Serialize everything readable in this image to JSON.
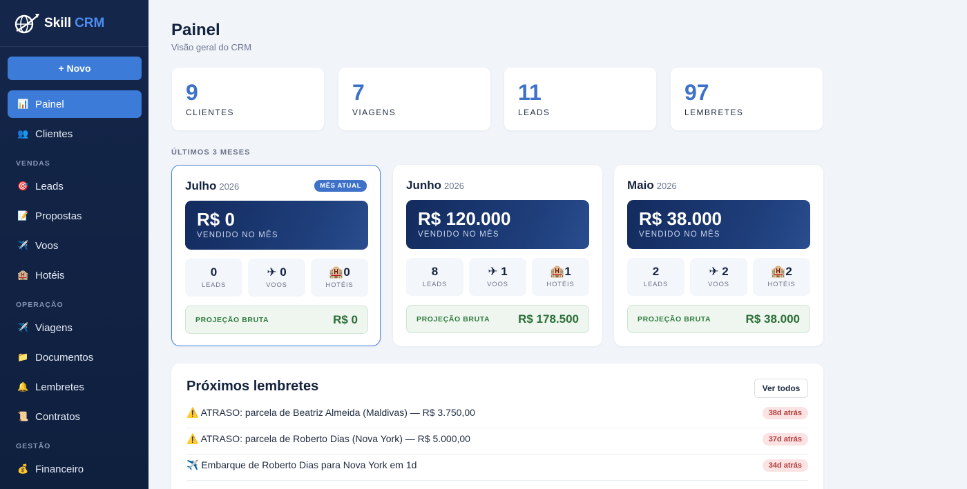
{
  "brand": {
    "name_part1": "Skill",
    "name_part2": "CRM"
  },
  "sidebar": {
    "new_button": "+ Novo",
    "items_top": [
      {
        "icon": "📊",
        "label": "Painel",
        "active": true
      },
      {
        "icon": "👥",
        "label": "Clientes"
      }
    ],
    "sections": [
      {
        "title": "VENDAS",
        "items": [
          {
            "icon": "🎯",
            "label": "Leads"
          },
          {
            "icon": "📝",
            "label": "Propostas"
          },
          {
            "icon": "✈️",
            "label": "Voos"
          },
          {
            "icon": "🏨",
            "label": "Hotéis"
          }
        ]
      },
      {
        "title": "OPERAÇÃO",
        "items": [
          {
            "icon": "✈️",
            "label": "Viagens"
          },
          {
            "icon": "📁",
            "label": "Documentos"
          },
          {
            "icon": "🔔",
            "label": "Lembretes"
          },
          {
            "icon": "📜",
            "label": "Contratos"
          }
        ]
      },
      {
        "title": "GESTÃO",
        "items": [
          {
            "icon": "💰",
            "label": "Financeiro"
          }
        ]
      }
    ]
  },
  "header": {
    "title": "Painel",
    "subtitle": "Visão geral do CRM"
  },
  "stats": [
    {
      "value": "9",
      "label": "CLIENTES"
    },
    {
      "value": "7",
      "label": "VIAGENS"
    },
    {
      "value": "11",
      "label": "LEADS"
    },
    {
      "value": "97",
      "label": "LEMBRETES"
    }
  ],
  "months_label": "ÚLTIMOS 3 MESES",
  "months": [
    {
      "name": "Julho",
      "year": "2026",
      "badge": "MÊS ATUAL",
      "current": true,
      "sold": "R$ 0",
      "sold_caption": "VENDIDO NO MÊS",
      "leads": "0",
      "leads_label": "LEADS",
      "voos": "0",
      "voos_label": "VOOS",
      "hoteis": "0",
      "hoteis_label": "HOTÉIS",
      "proj_label": "PROJEÇÃO BRUTA",
      "proj_value": "R$ 0"
    },
    {
      "name": "Junho",
      "year": "2026",
      "badge": "",
      "current": false,
      "sold": "R$ 120.000",
      "sold_caption": "VENDIDO NO MÊS",
      "leads": "8",
      "leads_label": "LEADS",
      "voos": "1",
      "voos_label": "VOOS",
      "hoteis": "1",
      "hoteis_label": "HOTÉIS",
      "proj_label": "PROJEÇÃO BRUTA",
      "proj_value": "R$ 178.500"
    },
    {
      "name": "Maio",
      "year": "2026",
      "badge": "",
      "current": false,
      "sold": "R$ 38.000",
      "sold_caption": "VENDIDO NO MÊS",
      "leads": "2",
      "leads_label": "LEADS",
      "voos": "2",
      "voos_label": "VOOS",
      "hoteis": "2",
      "hoteis_label": "HOTÉIS",
      "proj_label": "PROJEÇÃO BRUTA",
      "proj_value": "R$ 38.000"
    }
  ],
  "reminders": {
    "title": "Próximos lembretes",
    "view_all": "Ver todos",
    "items": [
      {
        "icon": "⚠️",
        "text": "ATRASO: parcela de Beatriz Almeida (Maldivas) — R$ 3.750,00",
        "age": "38d atrás"
      },
      {
        "icon": "⚠️",
        "text": "ATRASO: parcela de Roberto Dias (Nova York) — R$ 5.000,00",
        "age": "37d atrás"
      },
      {
        "icon": "✈️",
        "text": "Embarque de Roberto Dias para Nova York em 1d",
        "age": "34d atrás"
      }
    ]
  },
  "colors": {
    "sidebar_bg": "#14264a",
    "accent": "#3d7bd9",
    "stat_number": "#3d72c8",
    "overdue_tag_bg": "#fbe3e3"
  }
}
